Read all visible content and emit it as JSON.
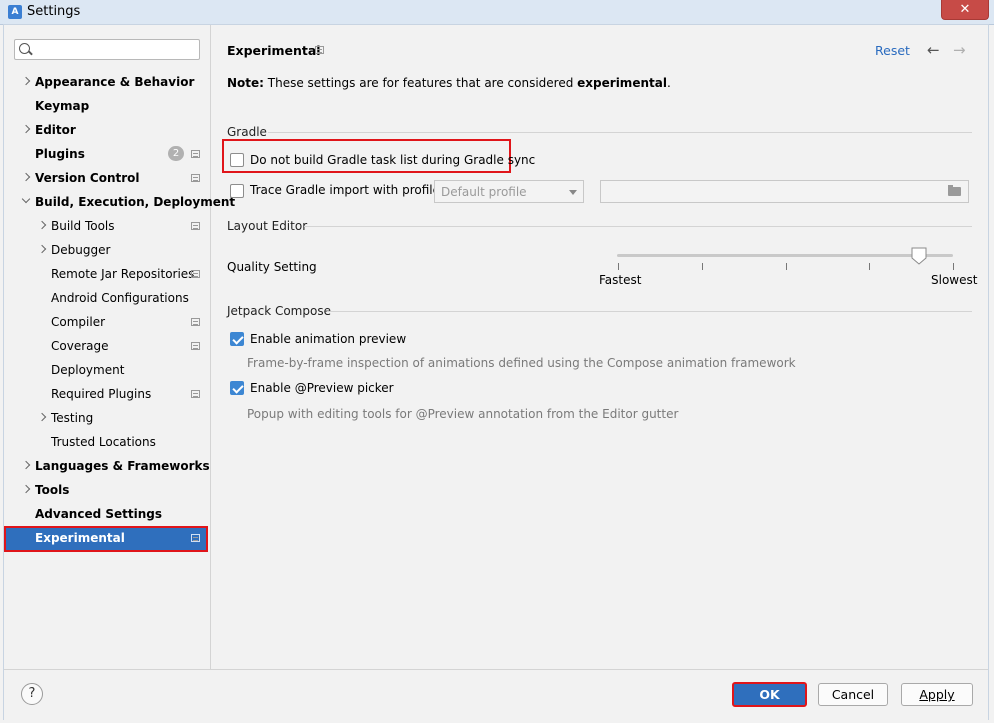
{
  "window": {
    "title": "Settings",
    "app_icon": "android-studio-icon",
    "close_glyph": "✕"
  },
  "search": {
    "placeholder": "",
    "icon": "search-icon"
  },
  "sidebar": {
    "items": [
      {
        "label": "Appearance & Behavior",
        "bold": true,
        "expandable": true,
        "expanded": false
      },
      {
        "label": "Keymap",
        "bold": true
      },
      {
        "label": "Editor",
        "bold": true,
        "expandable": true,
        "expanded": false
      },
      {
        "label": "Plugins",
        "bold": true,
        "badge": "2",
        "settings_icon": true
      },
      {
        "label": "Version Control",
        "bold": true,
        "expandable": true,
        "expanded": false,
        "settings_icon": true
      },
      {
        "label": "Build, Execution, Deployment",
        "bold": true,
        "expandable": true,
        "expanded": true
      },
      {
        "label": "Build Tools",
        "child": true,
        "expandable": true,
        "settings_icon": true
      },
      {
        "label": "Debugger",
        "child": true,
        "expandable": true
      },
      {
        "label": "Remote Jar Repositories",
        "child": true,
        "settings_icon": true
      },
      {
        "label": "Android Configurations",
        "child": true
      },
      {
        "label": "Compiler",
        "child": true,
        "settings_icon": true
      },
      {
        "label": "Coverage",
        "child": true,
        "settings_icon": true
      },
      {
        "label": "Deployment",
        "child": true
      },
      {
        "label": "Required Plugins",
        "child": true,
        "settings_icon": true
      },
      {
        "label": "Testing",
        "child": true,
        "expandable": true
      },
      {
        "label": "Trusted Locations",
        "child": true
      },
      {
        "label": "Languages & Frameworks",
        "bold": true,
        "expandable": true,
        "expanded": false
      },
      {
        "label": "Tools",
        "bold": true,
        "expandable": true,
        "expanded": false
      },
      {
        "label": "Advanced Settings",
        "bold": true
      },
      {
        "label": "Experimental",
        "bold": true,
        "selected": true,
        "settings_icon": true
      }
    ]
  },
  "main": {
    "title": "Experimental",
    "reset_label": "Reset",
    "back_glyph": "←",
    "forward_glyph": "→",
    "note_prefix": "Note:",
    "note_text": " These settings are for features that are considered ",
    "note_emphasis": "experimental",
    "note_suffix": ".",
    "gradle": {
      "section_title": "Gradle",
      "no_task_list_label": "Do not build Gradle task list during Gradle sync",
      "no_task_list_checked": false,
      "trace_import_label": "Trace Gradle import with profile:",
      "trace_import_checked": false,
      "profile_selected": "Default profile",
      "profile_path_value": ""
    },
    "layout_editor": {
      "section_title": "Layout Editor",
      "quality_label": "Quality Setting",
      "slider_min_label": "Fastest",
      "slider_max_label": "Slowest",
      "slider_level_fraction": 0.9
    },
    "compose": {
      "section_title": "Jetpack Compose",
      "animation_preview_label": "Enable animation preview",
      "animation_preview_checked": true,
      "animation_preview_desc": "Frame-by-frame inspection of animations defined using the Compose animation framework",
      "preview_picker_label": "Enable @Preview picker",
      "preview_picker_checked": true,
      "preview_picker_desc": "Popup with editing tools for @Preview annotation from the Editor gutter"
    }
  },
  "footer": {
    "help_label": "?",
    "ok_label": "OK",
    "cancel_label": "Cancel",
    "apply_label": "Apply"
  },
  "colors": {
    "selection": "#2f6fbd",
    "highlight_border": "#e0151a",
    "link": "#2a6bbf",
    "checkbox_checked": "#3d87d3"
  }
}
